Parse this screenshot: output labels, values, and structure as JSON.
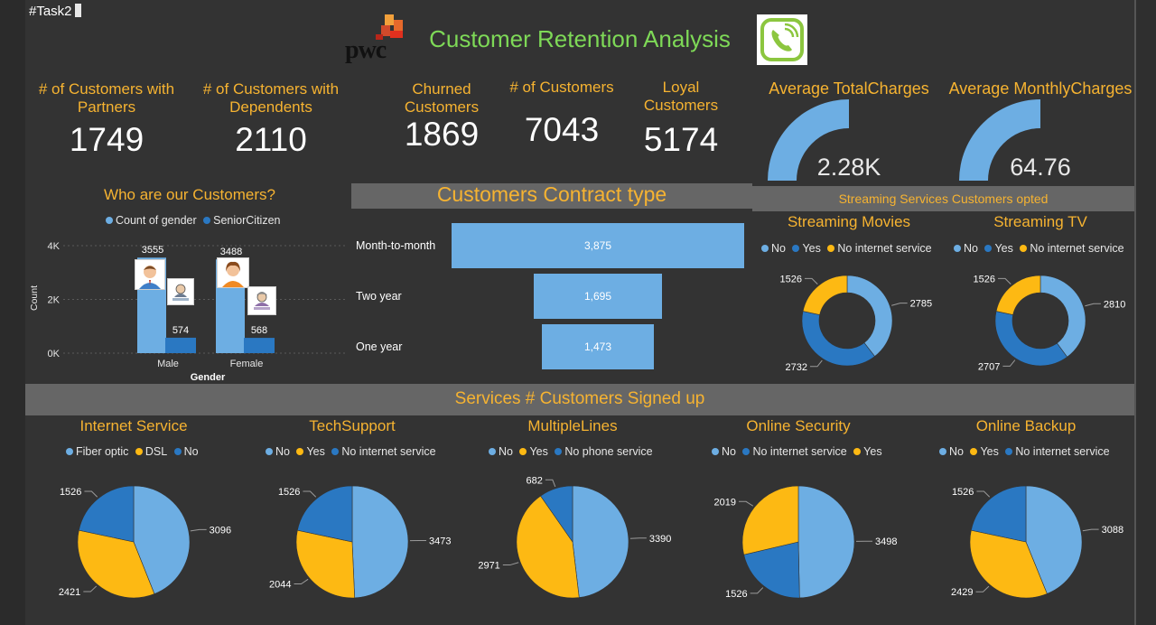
{
  "header": {
    "task_label": "#Task2",
    "pwc_logo_text": "pwc",
    "title": "Customer Retention Analysis"
  },
  "kpis": [
    {
      "label": "# of Customers with Partners",
      "value": "1749"
    },
    {
      "label": "# of Customers with Dependents",
      "value": "2110"
    },
    {
      "label": "Churned Customers",
      "value": "1869"
    },
    {
      "label": "# of Customers",
      "value": "7043"
    },
    {
      "label": "Loyal Customers",
      "value": "5174"
    }
  ],
  "gauges": [
    {
      "title": "Average TotalCharges",
      "display": "2.28K",
      "fill_fraction": 0.5
    },
    {
      "title": "Average MonthlyCharges",
      "display": "64.76",
      "fill_fraction": 0.5
    }
  ],
  "sections": {
    "streaming_band": "Streaming Services Customers opted",
    "services_band": "Services # Customers Signed up"
  },
  "colors": {
    "light_blue": "#6daee3",
    "dark_blue": "#2a78c2",
    "orange": "#fdb913",
    "accent_title": "#f6b331",
    "app_title": "#7ed957"
  },
  "icons": {
    "pwc": "pwc-logo-icon",
    "phone": "phone-logo-icon",
    "avatars": [
      "male-avatar-icon",
      "senior-male-avatar-icon",
      "female-avatar-icon",
      "senior-female-avatar-icon"
    ]
  },
  "chart_data": [
    {
      "id": "who",
      "type": "bar",
      "title": "Who are our Customers?",
      "categories": [
        "Male",
        "Female"
      ],
      "series": [
        {
          "name": "Count of gender",
          "values": [
            3555,
            3488
          ],
          "color": "#6daee3"
        },
        {
          "name": "SeniorCitizen",
          "values": [
            574,
            568
          ],
          "color": "#2a78c2"
        }
      ],
      "xlabel": "Gender",
      "ylabel": "Count",
      "yticks": [
        "0K",
        "2K",
        "4K"
      ],
      "ylim": [
        0,
        4000
      ],
      "grid": true,
      "legend": "top"
    },
    {
      "id": "contract",
      "type": "bar",
      "orientation": "funnel",
      "title": "Customers Contract type",
      "categories": [
        "Month-to-month",
        "Two year",
        "One year"
      ],
      "values": [
        3875,
        1695,
        1473
      ],
      "value_labels": [
        "3,875",
        "1,695",
        "1,473"
      ],
      "color": "#6daee3"
    },
    {
      "id": "movies",
      "type": "pie",
      "donut": true,
      "title": "Streaming Movies",
      "labels": [
        "No",
        "Yes",
        "No internet service"
      ],
      "values": [
        2785,
        2732,
        1526
      ],
      "colors": [
        "#6daee3",
        "#2a78c2",
        "#fdb913"
      ],
      "legend": "top"
    },
    {
      "id": "tv",
      "type": "pie",
      "donut": true,
      "title": "Streaming TV",
      "labels": [
        "No",
        "Yes",
        "No internet service"
      ],
      "values": [
        2810,
        2707,
        1526
      ],
      "colors": [
        "#6daee3",
        "#2a78c2",
        "#fdb913"
      ],
      "legend": "top"
    },
    {
      "id": "internet",
      "type": "pie",
      "title": "Internet Service",
      "labels": [
        "Fiber optic",
        "DSL",
        "No"
      ],
      "values": [
        3096,
        2421,
        1526
      ],
      "colors": [
        "#6daee3",
        "#fdb913",
        "#2a78c2"
      ],
      "legend": "top"
    },
    {
      "id": "techsupport",
      "type": "pie",
      "title": "TechSupport",
      "labels": [
        "No",
        "Yes",
        "No internet service"
      ],
      "values": [
        3473,
        2044,
        1526
      ],
      "colors": [
        "#6daee3",
        "#fdb913",
        "#2a78c2"
      ],
      "legend": "top"
    },
    {
      "id": "multiplelines",
      "type": "pie",
      "title": "MultipleLines",
      "labels": [
        "No",
        "Yes",
        "No phone service"
      ],
      "values": [
        3390,
        2971,
        682
      ],
      "colors": [
        "#6daee3",
        "#fdb913",
        "#2a78c2"
      ],
      "legend": "top"
    },
    {
      "id": "onlinesecurity",
      "type": "pie",
      "title": "Online Security",
      "labels": [
        "No",
        "No internet service",
        "Yes"
      ],
      "values": [
        3498,
        1526,
        2019
      ],
      "colors": [
        "#6daee3",
        "#2a78c2",
        "#fdb913"
      ],
      "legend": "top"
    },
    {
      "id": "onlinebackup",
      "type": "pie",
      "title": "Online Backup",
      "labels": [
        "No",
        "Yes",
        "No internet service"
      ],
      "values": [
        3088,
        2429,
        1526
      ],
      "colors": [
        "#6daee3",
        "#fdb913",
        "#2a78c2"
      ],
      "legend": "top"
    }
  ]
}
